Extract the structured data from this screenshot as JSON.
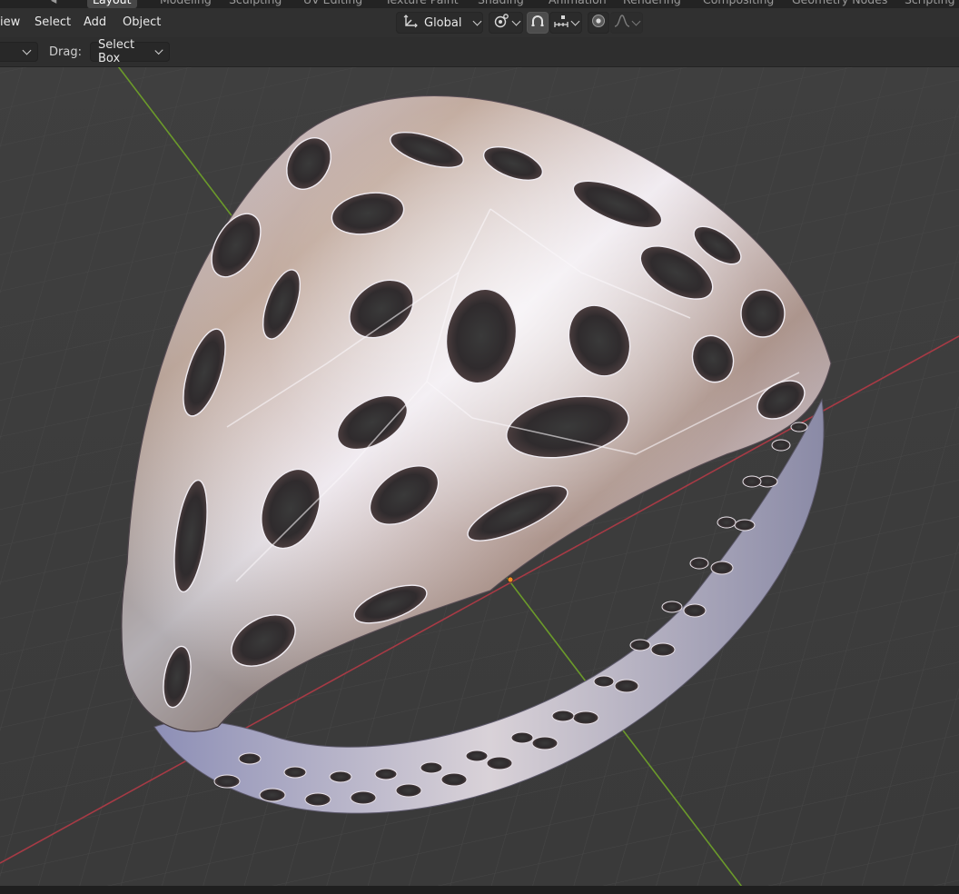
{
  "workspace_tabs": [
    {
      "label": "Layout",
      "active": true
    },
    {
      "label": "Modeling"
    },
    {
      "label": "Sculpting"
    },
    {
      "label": "UV Editing"
    },
    {
      "label": "Texture Paint"
    },
    {
      "label": "Shading"
    },
    {
      "label": "Animation"
    },
    {
      "label": "Rendering"
    },
    {
      "label": "Compositing"
    },
    {
      "label": "Geometry Nodes"
    },
    {
      "label": "Scripting"
    }
  ],
  "header": {
    "menus": {
      "view": "iew",
      "select": "Select",
      "add": "Add",
      "object": "Object"
    },
    "transform_orientation": "Global"
  },
  "toolbar": {
    "drag_label": "Drag:",
    "drag_value": "Select Box"
  },
  "viewport": {
    "object": "ring",
    "material_colors": {
      "highlight": "#f1ecf1",
      "warm": "#bda495",
      "cool": "#8c8db8",
      "shadow": "#4a3d3f"
    },
    "grid_color": "#474747",
    "x_axis_color": "#a73a45",
    "y_axis_color": "#6b9a2a"
  },
  "icons": {
    "orientation": "transform-orientation-icon",
    "pivot": "pivot-point-icon",
    "snap": "snap-icon",
    "snap_increment": "snap-increment-icon",
    "proportional": "proportional-editing-icon",
    "falloff": "falloff-curve-icon"
  }
}
